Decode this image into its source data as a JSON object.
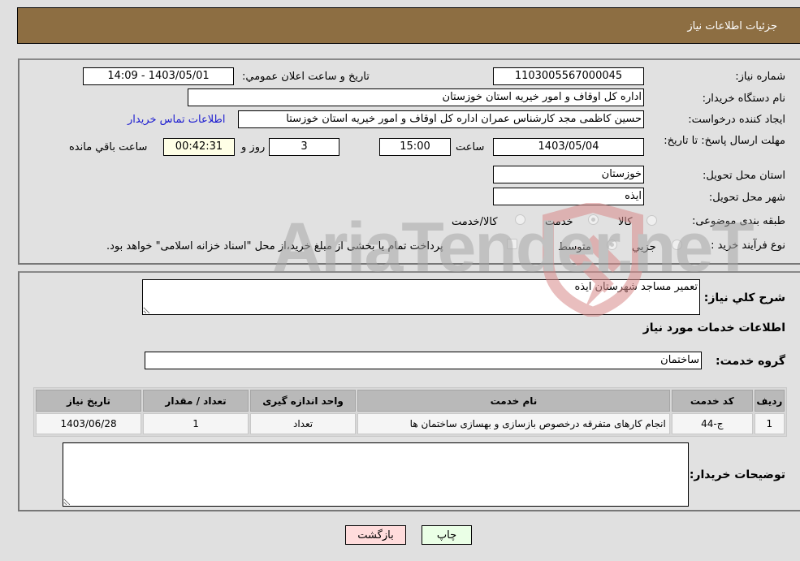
{
  "header": {
    "title": "جزئیات اطلاعات نیاز"
  },
  "form": {
    "need_number_label": "شماره نیاز:",
    "need_number": "1103005567000045",
    "announce_label": "تاریخ و ساعت اعلان عمومي:",
    "announce_value": "1403/05/01 - 14:09",
    "buyer_org_label": "نام دستگاه خریدار:",
    "buyer_org": "اداره کل اوقاف و امور خیریه استان خوزستان",
    "requester_label": "ایجاد کننده درخواست:",
    "requester": "حسین کاظمی مجد کارشناس عمران اداره کل اوقاف و امور خیریه استان خوزستا",
    "buyer_contact_link": "اطلاعات تماس خریدار",
    "deadline_label": "مهلت ارسال پاسخ: تا تاریخ:",
    "deadline_date": "1403/05/04",
    "time_label": "ساعت",
    "deadline_time": "15:00",
    "days_value": "3",
    "days_label": "روز و",
    "remaining_time": "00:42:31",
    "remaining_label": "ساعت باقي مانده",
    "province_label": "استان محل تحویل:",
    "province": "خوزستان",
    "city_label": "شهر محل تحویل:",
    "city": "ایذه",
    "category_label": "طبقه بندی موضوعی:",
    "category_options": [
      {
        "label": "کالا",
        "checked": false
      },
      {
        "label": "خدمت",
        "checked": true
      },
      {
        "label": "کالا/خدمت",
        "checked": false
      }
    ],
    "purchase_type_label": "نوع فرآیند خرید :",
    "purchase_type_options": [
      {
        "label": "جزيي",
        "checked": false
      },
      {
        "label": "متوسط",
        "checked": true
      }
    ],
    "treasury_note": "پرداخت تمام یا بخشی از مبلغ خرید،از محل \"اسناد خزانه اسلامی\" خواهد بود."
  },
  "details": {
    "summary_label": "شرح کلي نیاز:",
    "summary": "تعمیر مساجد شهرستان ایذه",
    "services_heading": "اطلاعات خدمات مورد نیاز",
    "service_group_label": "گروه خدمت:",
    "service_group": "ساختمان",
    "table": {
      "headers": [
        "ردیف",
        "کد خدمت",
        "نام خدمت",
        "واحد اندازه گیری",
        "تعداد / مقدار",
        "تاریخ نیاز"
      ],
      "rows": [
        [
          "1",
          "ج-44",
          "انجام کارهای متفرقه درخصوص بازسازی و بهسازی ساختمان ها",
          "تعداد",
          "1",
          "1403/06/28"
        ]
      ]
    },
    "buyer_notes_label": "توضیحات خریدار:",
    "buyer_notes": ""
  },
  "buttons": {
    "print": "چاپ",
    "back": "بازگشت"
  },
  "watermark": {
    "text": "AriaTender.neT"
  },
  "colors": {
    "header_bg": "#8d6e42",
    "link": "#1a1ad0",
    "back_bg": "#ffdcdc",
    "print_bg": "#eaffe6",
    "remaining_bg": "#ffffe6"
  }
}
